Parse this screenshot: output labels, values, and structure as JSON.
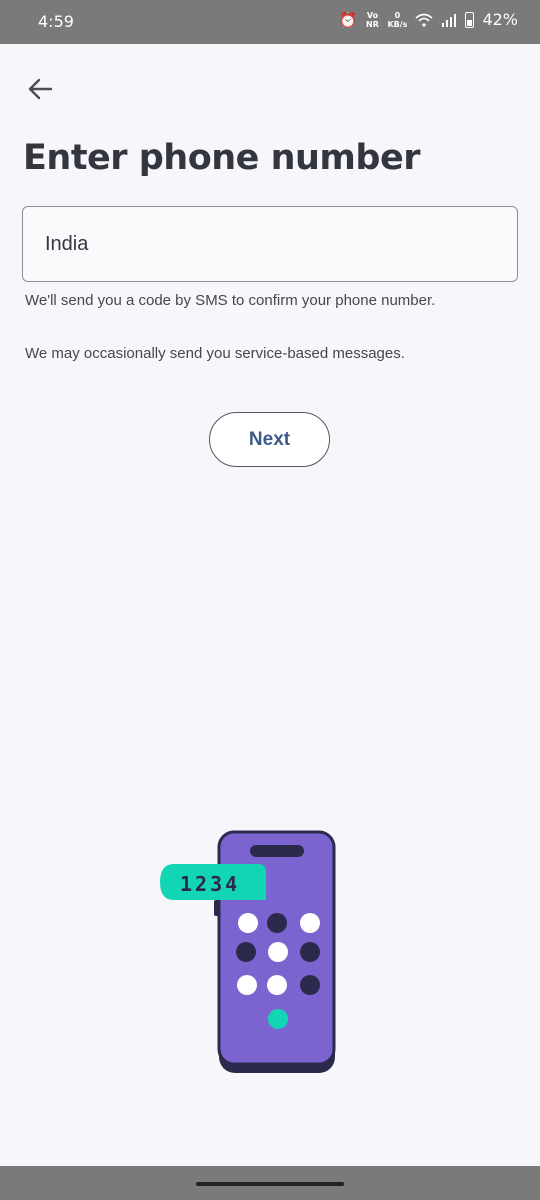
{
  "status_bar": {
    "time": "4:59",
    "alarm_icon": "alarm-clock-icon",
    "volte_label": "Vo NR",
    "network_speed_value": "0",
    "network_speed_unit": "KB/s",
    "wifi_icon": "wifi-icon",
    "signal_icon": "signal-bars-icon",
    "battery_icon": "battery-icon",
    "battery_percent": "42%"
  },
  "header": {
    "back_icon": "arrow-left-icon",
    "title": "Enter phone number"
  },
  "form": {
    "country_value": "India",
    "helper_sms": "We'll send you a code by SMS to confirm your phone number.",
    "helper_service": "We may occasionally send you service-based messages.",
    "next_label": "Next"
  },
  "illustration": {
    "bubble_code": "1234",
    "colors": {
      "phone_body": "#7b64d0",
      "phone_outline": "#2b2a4c",
      "bubble": "#12d6b3",
      "dot_light": "#ffffff",
      "dot_dark": "#2b2a4c",
      "dot_accent": "#12d6b3"
    }
  },
  "colors": {
    "background": "#f7f7fb",
    "title": "#34363f",
    "next_text": "#3d5a8a",
    "system_bars": "#7a7a7a"
  }
}
